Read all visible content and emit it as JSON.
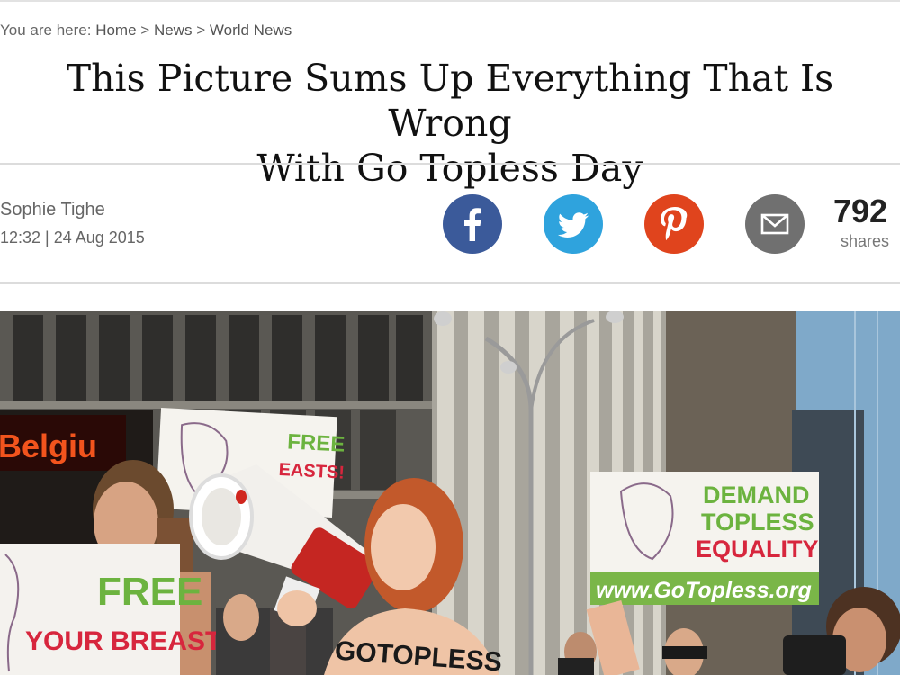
{
  "breadcrumb": {
    "prefix": "You are here:",
    "items": [
      "Home",
      "News",
      "World News"
    ],
    "sep": ">"
  },
  "article": {
    "title_line1": "This Picture Sums Up Everything That Is Wrong",
    "title_line2": "With Go Topless Day",
    "author": "Sophie Tighe",
    "datetime": "12:32 | 24 Aug 2015"
  },
  "social": {
    "facebook": "facebook-icon",
    "twitter": "twitter-icon",
    "pinterest": "pinterest-icon",
    "email": "email-icon",
    "count": "792",
    "count_label": "shares"
  },
  "photo": {
    "store_sign": "Belgiu",
    "left_sign_line1": "FREE",
    "left_sign_line2": "YOUR BREASTS!",
    "center_sign_line1": "FREE",
    "center_sign_line2": "EASTS!",
    "right_sign_line1": "DEMAND",
    "right_sign_line2": "TOPLESS",
    "right_sign_line3": "EQUALITY",
    "right_sign_url": "www.GoTopless.org",
    "body_text": "GOTOPLESS"
  },
  "colors": {
    "facebook": "#3b5a9a",
    "twitter": "#2fa3dd",
    "pinterest": "#e0441d",
    "email": "#707070"
  }
}
